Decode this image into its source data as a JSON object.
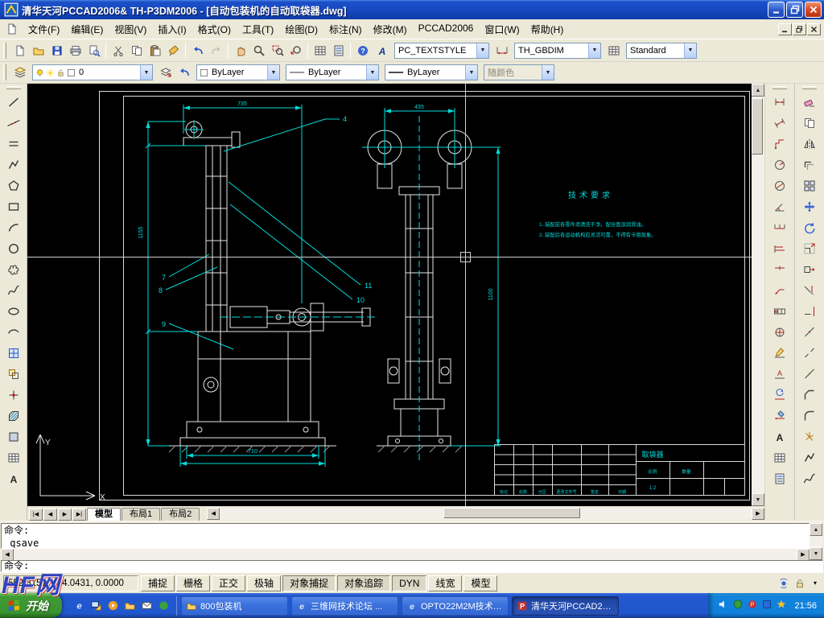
{
  "titlebar": {
    "title": "清华天河PCCAD2006& TH-P3DM2006 - [自动包装机的自动取袋器.dwg]"
  },
  "menubar": {
    "items": [
      {
        "key": "file",
        "label": "文件(F)"
      },
      {
        "key": "edit",
        "label": "编辑(E)"
      },
      {
        "key": "view",
        "label": "视图(V)"
      },
      {
        "key": "insert",
        "label": "插入(I)"
      },
      {
        "key": "format",
        "label": "格式(O)"
      },
      {
        "key": "tools",
        "label": "工具(T)"
      },
      {
        "key": "draw",
        "label": "绘图(D)"
      },
      {
        "key": "dimension",
        "label": "标注(N)"
      },
      {
        "key": "modify",
        "label": "修改(M)"
      },
      {
        "key": "pccad",
        "label": "PCCAD2006"
      },
      {
        "key": "window",
        "label": "窗口(W)"
      },
      {
        "key": "help",
        "label": "帮助(H)"
      }
    ]
  },
  "toolbar_standard": {
    "icons": [
      {
        "name": "qnew",
        "glyph": "sheet"
      },
      {
        "name": "open",
        "glyph": "folder"
      },
      {
        "name": "save",
        "glyph": "floppy"
      },
      {
        "name": "plot",
        "glyph": "printer"
      },
      {
        "name": "plot-preview",
        "glyph": "preview"
      },
      {
        "sep": true
      },
      {
        "name": "cut",
        "glyph": "scissors"
      },
      {
        "name": "copy-clip",
        "glyph": "copy"
      },
      {
        "name": "paste-clip",
        "glyph": "paste"
      },
      {
        "name": "match-properties",
        "glyph": "brush"
      },
      {
        "sep": true
      },
      {
        "name": "undo",
        "glyph": "undo"
      },
      {
        "name": "redo",
        "glyph": "redo",
        "disabled": true
      },
      {
        "sep": true
      },
      {
        "name": "pan-realtime",
        "glyph": "hand"
      },
      {
        "name": "zoom-realtime",
        "glyph": "zoom"
      },
      {
        "name": "zoom-window",
        "glyph": "zoomwin"
      },
      {
        "name": "zoom-previous",
        "glyph": "zoomprev"
      },
      {
        "sep": true
      },
      {
        "name": "design-center",
        "glyph": "grid"
      },
      {
        "name": "tool-palettes",
        "glyph": "props"
      },
      {
        "sep": true
      },
      {
        "name": "help",
        "glyph": "help"
      }
    ],
    "text_style": "PC_TEXTSTYLE",
    "dim_style": "TH_GBDIM",
    "table_style": "Standard"
  },
  "toolbar_properties": {
    "icons_left": [
      {
        "name": "layer-properties-manager",
        "glyph": "layers"
      }
    ],
    "icons_right": [
      {
        "name": "make-object-layer-current",
        "glyph": "laycur"
      },
      {
        "name": "layer-previous",
        "glyph": "undo"
      }
    ],
    "layer": "0",
    "color": "ByLayer",
    "linetype": "ByLayer",
    "lineweight": "ByLayer",
    "plot_style": "随颜色"
  },
  "palettes": {
    "draw": [
      {
        "name": "line",
        "glyph": "line"
      },
      {
        "name": "construction-line",
        "glyph": "xline"
      },
      {
        "name": "multiline",
        "glyph": "mline"
      },
      {
        "name": "polyline",
        "glyph": "pline"
      },
      {
        "name": "polygon",
        "glyph": "polygon"
      },
      {
        "name": "rectangle",
        "glyph": "rect"
      },
      {
        "name": "arc",
        "glyph": "arc"
      },
      {
        "name": "circle",
        "glyph": "circle"
      },
      {
        "name": "revision-cloud",
        "glyph": "revcloud"
      },
      {
        "name": "spline",
        "glyph": "spline"
      },
      {
        "name": "ellipse",
        "glyph": "ellipse"
      },
      {
        "name": "ellipse-arc",
        "glyph": "earc"
      },
      {
        "name": "insert-block",
        "glyph": "insert"
      },
      {
        "name": "make-block",
        "glyph": "mkblock"
      },
      {
        "name": "point",
        "glyph": "point"
      },
      {
        "name": "hatch",
        "glyph": "hatch"
      },
      {
        "name": "region",
        "glyph": "region"
      },
      {
        "name": "table",
        "glyph": "grid"
      },
      {
        "name": "multiline-text",
        "glyph": "mtext"
      }
    ],
    "modify": [
      {
        "name": "erase",
        "glyph": "erase"
      },
      {
        "name": "copy-object",
        "glyph": "copy"
      },
      {
        "name": "mirror",
        "glyph": "mirror"
      },
      {
        "name": "offset",
        "glyph": "offset"
      },
      {
        "name": "array",
        "glyph": "array"
      },
      {
        "name": "move",
        "glyph": "move"
      },
      {
        "name": "rotate",
        "glyph": "rotate"
      },
      {
        "name": "scale",
        "glyph": "scale"
      },
      {
        "name": "stretch",
        "glyph": "stretch"
      },
      {
        "name": "trim",
        "glyph": "trim"
      },
      {
        "name": "extend",
        "glyph": "extend"
      },
      {
        "name": "break-at-point",
        "glyph": "breakpt"
      },
      {
        "name": "break",
        "glyph": "breakobj"
      },
      {
        "name": "join",
        "glyph": "join"
      },
      {
        "name": "chamfer",
        "glyph": "chamfer"
      },
      {
        "name": "fillet",
        "glyph": "fillet"
      },
      {
        "name": "explode",
        "glyph": "explode"
      },
      {
        "name": "polyline-edit",
        "glyph": "pline"
      },
      {
        "name": "spline-edit",
        "glyph": "spline"
      }
    ],
    "dimension": [
      {
        "name": "dim-linear",
        "glyph": "dlin"
      },
      {
        "name": "dim-aligned",
        "glyph": "dalg"
      },
      {
        "name": "dim-ordinate",
        "glyph": "dord"
      },
      {
        "name": "dim-radius",
        "glyph": "drad"
      },
      {
        "name": "dim-diameter",
        "glyph": "ddia"
      },
      {
        "name": "dim-angular",
        "glyph": "dang"
      },
      {
        "name": "quick-dim",
        "glyph": "qdim"
      },
      {
        "name": "dim-baseline",
        "glyph": "dbase"
      },
      {
        "name": "dim-continue",
        "glyph": "dcont"
      },
      {
        "name": "quick-leader",
        "glyph": "leader"
      },
      {
        "name": "tolerance",
        "glyph": "tol"
      },
      {
        "name": "center-mark",
        "glyph": "cmark"
      },
      {
        "name": "dim-edit",
        "glyph": "dedit"
      },
      {
        "name": "dim-text-edit",
        "glyph": "dtedit"
      },
      {
        "name": "dim-update",
        "glyph": "dupd"
      },
      {
        "name": "dim-style",
        "glyph": "dstyle"
      },
      {
        "name": "single-text",
        "glyph": "mtext"
      },
      {
        "name": "insert-table",
        "glyph": "grid"
      },
      {
        "name": "field",
        "glyph": "props"
      }
    ]
  },
  "canvas": {
    "tabs": [
      {
        "label": "模型",
        "active": true
      },
      {
        "label": "布局1",
        "active": false
      },
      {
        "label": "布局2",
        "active": false
      }
    ]
  },
  "command": {
    "lines": [
      "命令:",
      "_qsave",
      "命令:"
    ]
  },
  "status": {
    "coords": "552.3151, 424.0431, 0.0000",
    "toggles": [
      {
        "key": "snap",
        "label": "捕捉",
        "on": false
      },
      {
        "key": "grid",
        "label": "栅格",
        "on": false
      },
      {
        "key": "ortho",
        "label": "正交",
        "on": false
      },
      {
        "key": "polar",
        "label": "极轴",
        "on": false
      },
      {
        "key": "osnap",
        "label": "对象捕捉",
        "on": true
      },
      {
        "key": "otrack",
        "label": "对象追踪",
        "on": true
      },
      {
        "key": "dyn",
        "label": "DYN",
        "on": true
      },
      {
        "key": "lwt",
        "label": "线宽",
        "on": false
      },
      {
        "key": "model",
        "label": "模型",
        "on": false
      }
    ],
    "right_icons": [
      {
        "name": "comm-center-icon",
        "glyph": "sat"
      },
      {
        "name": "lock-icon",
        "glyph": "lock"
      }
    ]
  },
  "taskbar": {
    "start": "开始",
    "quick_launch": [
      {
        "name": "ie-icon",
        "glyph": "e"
      },
      {
        "name": "show-desktop-icon",
        "glyph": "desk"
      },
      {
        "name": "media-player-icon",
        "glyph": "mp"
      },
      {
        "name": "folder-icon",
        "glyph": "folder"
      },
      {
        "name": "mail-icon",
        "glyph": "env"
      },
      {
        "name": "messenger-icon",
        "glyph": "greenball"
      }
    ],
    "tasks": [
      {
        "label": "800包装机",
        "glyph": "folder",
        "active": false
      },
      {
        "label": "三维网技术论坛 ...",
        "glyph": "e",
        "active": false
      },
      {
        "label": "OPTO22M2M技术最...",
        "glyph": "e",
        "active": false
      },
      {
        "label": "清华天河PCCAD200...",
        "glyph": "pccad",
        "active": true
      }
    ],
    "tray": {
      "icons": [
        {
          "name": "volume-icon",
          "glyph": "vol"
        },
        {
          "name": "antivirus-icon",
          "glyph": "shield"
        },
        {
          "name": "pccad-tray-icon",
          "glyph": "reddot"
        },
        {
          "name": "network-icon",
          "glyph": "bluechip"
        },
        {
          "name": "update-icon",
          "glyph": "yellowstar"
        }
      ],
      "time": "21:56"
    }
  },
  "drawing": {
    "tech_title": "技术要求",
    "tech_lines": [
      "1. 装配前各零件须清洗干净，配合面涂润滑油。",
      "2. 装配后各运动机构应灵活可靠，不得有卡阻现象。"
    ],
    "balloons": [
      "4",
      "7",
      "8",
      "9",
      "10",
      "11"
    ],
    "dims": [
      "735",
      "1155",
      "710",
      "435",
      "1100"
    ],
    "ucs": {
      "x": "X",
      "y": "Y"
    },
    "title_block": {
      "part_name": "取袋器",
      "scale_label": "比例",
      "scale": "1:2",
      "qty_label": "数量",
      "labels": [
        "标记",
        "处数",
        "分区",
        "更改文件号",
        "签名",
        "日期"
      ]
    }
  },
  "watermark": {
    "text": "HF网"
  }
}
